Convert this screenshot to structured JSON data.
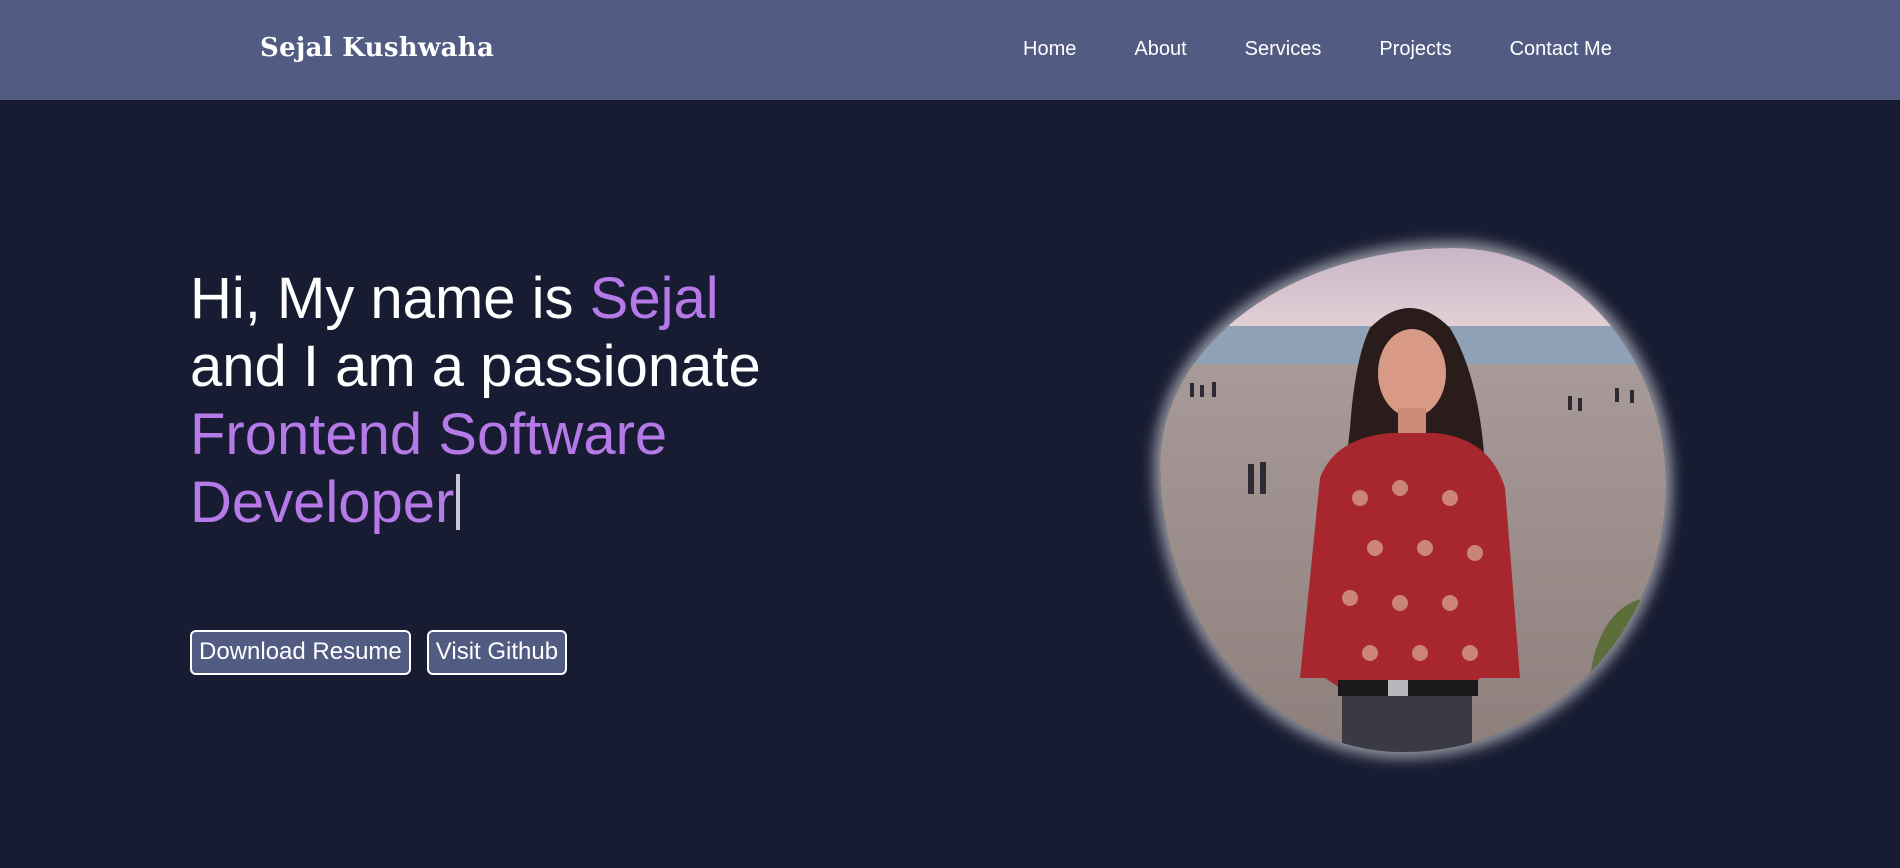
{
  "navbar": {
    "brand": "Sejal Kushwaha",
    "links": [
      "Home",
      "About",
      "Services",
      "Projects",
      "Contact Me"
    ]
  },
  "hero": {
    "line1_prefix": "Hi, My name is ",
    "line1_name": "Sejal",
    "line2": "and I am a passionate",
    "line3": "Frontend Software",
    "line4": "Developer"
  },
  "buttons": {
    "resume": "Download Resume",
    "github": "Visit Github"
  },
  "profile_photo": {
    "description": "profile-photo"
  },
  "colors": {
    "nav_bg": "#525b82",
    "page_bg": "#181c32",
    "accent": "#b57ae8"
  }
}
